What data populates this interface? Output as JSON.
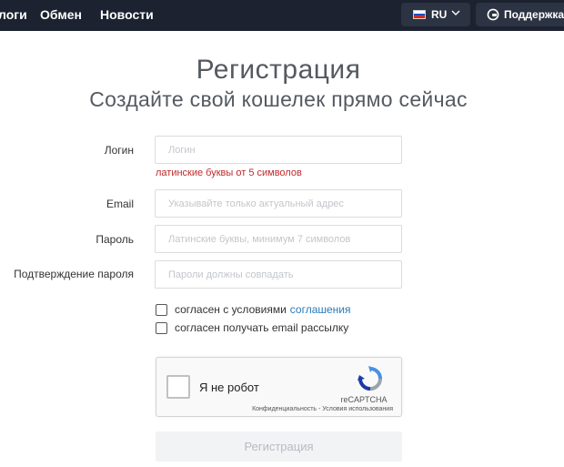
{
  "nav": {
    "links": [
      "логи",
      "Обмен",
      "Новости"
    ],
    "language": "RU",
    "support": "Поддержка"
  },
  "header": {
    "title": "Регистрация",
    "subtitle": "Создайте свой кошелек прямо сейчас"
  },
  "form": {
    "login": {
      "label": "Логин",
      "placeholder": "Логин",
      "error": "латинские буквы от 5 символов"
    },
    "email": {
      "label": "Email",
      "placeholder": "Указывайте только актуальный адрес"
    },
    "password": {
      "label": "Пароль",
      "placeholder": "Латинские буквы, минимум 7 символов"
    },
    "password_confirm": {
      "label": "Подтверждение пароля",
      "placeholder": "Пароли должны совпадать"
    },
    "agree_terms": {
      "text": "согласен с условиями",
      "link": "соглашения",
      "checked": false
    },
    "agree_newsletter": {
      "text": "согласен получать email рассылку",
      "checked": false
    },
    "submit": "Регистрация"
  },
  "recaptcha": {
    "label": "Я не робот",
    "brand": "reCAPTCHA",
    "terms": "Конфиденциальность - Условия использования"
  },
  "colors": {
    "nav_bg": "#1c2230",
    "error": "#c02a2a",
    "link": "#2a7ab8"
  }
}
